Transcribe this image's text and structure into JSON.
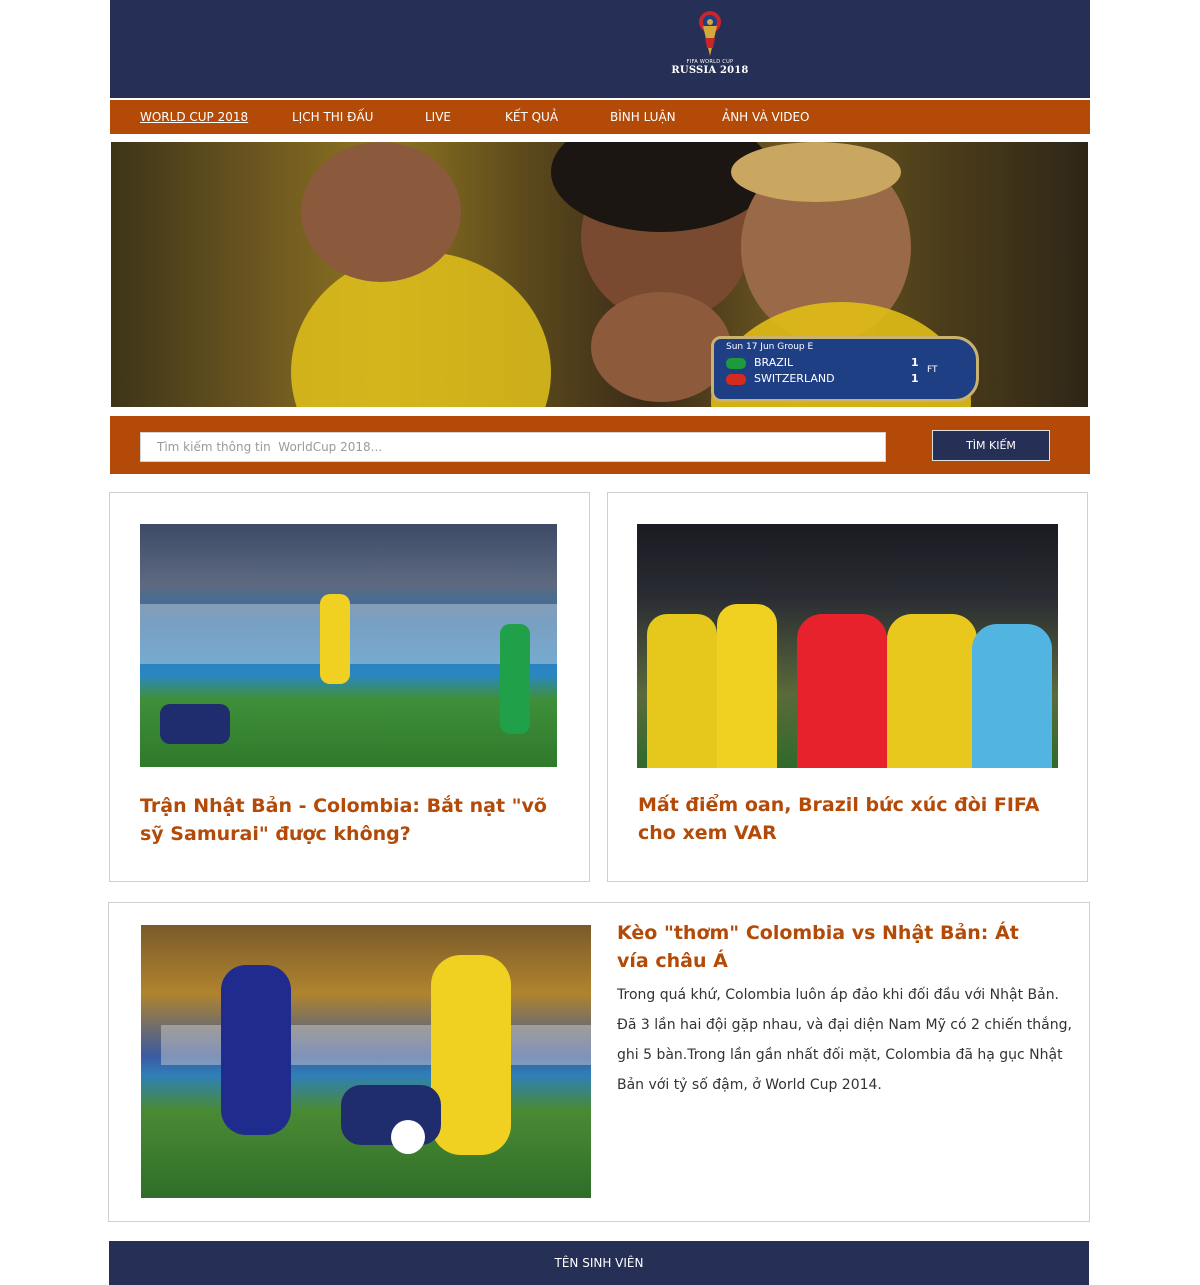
{
  "header": {
    "logo_line1": "FIFA WORLD CUP",
    "logo_line2": "RUSSIA 2018"
  },
  "nav": {
    "items": [
      {
        "label": "WORLD CUP 2018",
        "active": true
      },
      {
        "label": "LỊCH THI ĐẤU"
      },
      {
        "label": "LIVE"
      },
      {
        "label": "KẾT QUẢ"
      },
      {
        "label": "BÌNH LUẬN"
      },
      {
        "label": "ẢNH VÀ VIDEO"
      }
    ]
  },
  "hero": {
    "scoreboard": {
      "meta": "Sun 17 Jun Group E",
      "home_team": "BRAZIL",
      "home_score": "1",
      "away_team": "SWITZERLAND",
      "away_score": "1",
      "status": "FT"
    }
  },
  "search": {
    "placeholder": "Tìm kiếm thông tin  WorldCup 2018...",
    "button_label": "TÌM KIẾM"
  },
  "articles": [
    {
      "title": "Trận Nhật Bản - Colombia: Bắt nạt \"võ sỹ Samurai\" được không?"
    },
    {
      "title": "Mất điểm oan, Brazil bức xúc đòi FIFA cho xem VAR"
    },
    {
      "title": "Kèo \"thơm\" Colombia vs Nhật Bản: Át vía châu Á",
      "description": "Trong quá khứ, Colombia luôn áp đảo khi đối đầu với Nhật Bản. Đã 3 lần hai đội gặp nhau, và đại diện Nam Mỹ có 2 chiến thắng, ghi 5 bàn.Trong lần gần nhất đối mặt, Colombia đã hạ gục Nhật Bản với tỷ số đậm, ở World Cup 2014."
    }
  ],
  "footer": {
    "text": "TÊN SINH VIÊN"
  },
  "colors": {
    "navy": "#262f55",
    "orange": "#b34a07"
  }
}
